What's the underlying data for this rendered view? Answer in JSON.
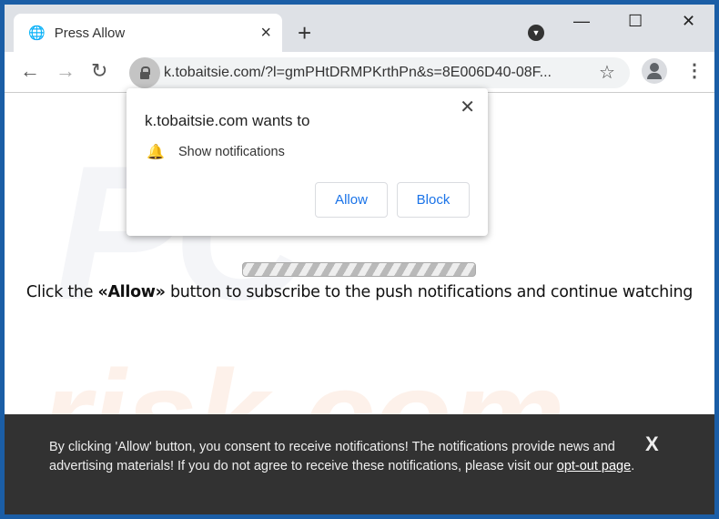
{
  "browser": {
    "tab_title": "Press Allow",
    "tab_close": "×",
    "new_tab": "+",
    "url": "k.tobaitsie.com/?l=gmPHtDRMPKrthPn&s=8E006D40-08F...",
    "window_controls": {
      "minimize": "—",
      "maximize": "☐",
      "close": "✕"
    },
    "icons": {
      "back": "←",
      "forward": "→",
      "reload": "↻",
      "star": "☆",
      "menu": "⋮",
      "globe": "🌐",
      "dropdown": "▼"
    }
  },
  "popup": {
    "title": "k.tobaitsie.com wants to",
    "permission": "Show notifications",
    "bell": "🔔",
    "close": "✕",
    "allow": "Allow",
    "block": "Block"
  },
  "page": {
    "msg_pre": "Click the ",
    "msg_bold": "«Allow»",
    "msg_post": " button to subscribe to the push notifications and continue watching",
    "watermark_top": "PC",
    "watermark_bottom": "risk.com"
  },
  "footer": {
    "text": "By clicking 'Allow' button, you consent to receive notifications! The notifications provide news and advertising materials! If you do not agree to receive these notifications, please visit our ",
    "link": "opt-out page",
    "end": ".",
    "close": "X"
  },
  "colors": {
    "frame": "#1b5ea6",
    "accent": "#1a73e8",
    "footer_bg": "#323232"
  }
}
